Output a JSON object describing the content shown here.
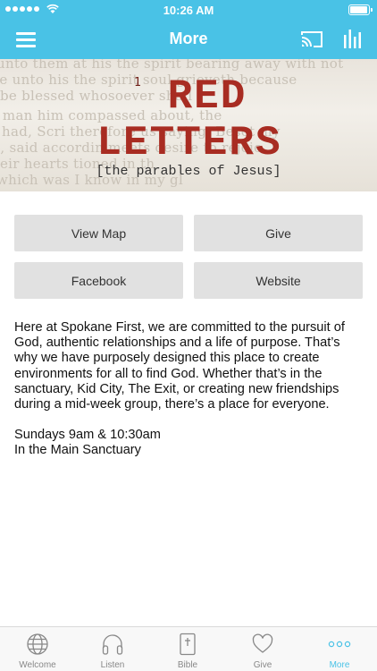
{
  "status_bar": {
    "time": "10:26 AM"
  },
  "navbar": {
    "title": "More"
  },
  "banner": {
    "number": "1",
    "line1": "RED",
    "line2": "LETTERS",
    "subtitle": "[the parables of Jesus]"
  },
  "buttons": {
    "view_map": "View Map",
    "give": "Give",
    "facebook": "Facebook",
    "website": "Website"
  },
  "content": {
    "description": "Here at Spokane First, we are committed to the pursuit of God, authentic relationships and a life of purpose. That’s why we have purposely designed this place to create environments for all to find God. Whether that’s in the sanctuary, Kid City, The Exit, or creating new friendships during a mid-week group, there’s a place for everyone.",
    "service_times": "Sundays 9am & 10:30am",
    "service_location": "In the Main Sanctuary"
  },
  "tabs": [
    {
      "label": "Welcome",
      "icon": "globe-icon"
    },
    {
      "label": "Listen",
      "icon": "headphones-icon"
    },
    {
      "label": "Bible",
      "icon": "bible-icon"
    },
    {
      "label": "Give",
      "icon": "heart-icon"
    },
    {
      "label": "More",
      "icon": "more-dots-icon"
    }
  ],
  "colors": {
    "accent": "#49c2e6",
    "banner_red": "#a82c22",
    "button_bg": "#e1e1e1",
    "tab_inactive": "#888888"
  }
}
